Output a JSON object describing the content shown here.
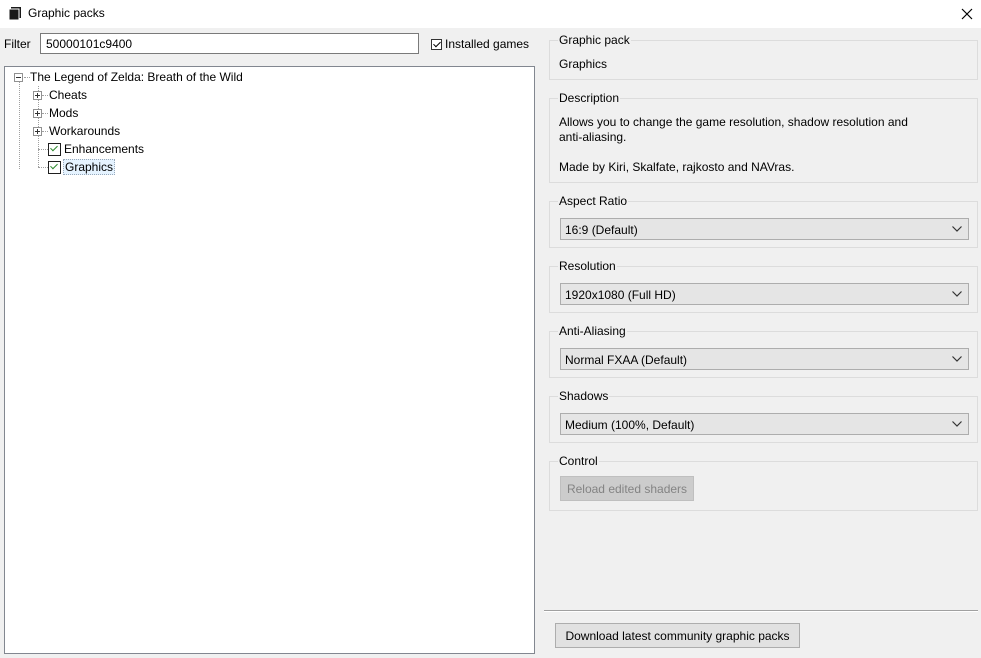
{
  "window": {
    "title": "Graphic packs"
  },
  "filter": {
    "label": "Filter",
    "value": "50000101c9400",
    "installed_games_label": "Installed games",
    "installed_games_checked": true
  },
  "tree": {
    "root": "The Legend of Zelda: Breath of the Wild",
    "items": [
      {
        "label": "Cheats",
        "type": "folder"
      },
      {
        "label": "Mods",
        "type": "folder"
      },
      {
        "label": "Workarounds",
        "type": "folder"
      },
      {
        "label": "Enhancements",
        "type": "pack",
        "checked": true
      },
      {
        "label": "Graphics",
        "type": "pack",
        "checked": true,
        "selected": true
      }
    ]
  },
  "details": {
    "graphic_pack": {
      "title": "Graphic pack",
      "value": "Graphics"
    },
    "description": {
      "title": "Description",
      "line1": "Allows you to change the game resolution, shadow resolution and",
      "line2": "anti-aliasing.",
      "line3": "Made by Kiri, Skalfate, rajkosto and NAVras."
    },
    "aspect_ratio": {
      "title": "Aspect Ratio",
      "value": "16:9 (Default)"
    },
    "resolution": {
      "title": "Resolution",
      "value": "1920x1080 (Full HD)"
    },
    "anti_aliasing": {
      "title": "Anti-Aliasing",
      "value": "Normal FXAA (Default)"
    },
    "shadows": {
      "title": "Shadows",
      "value": "Medium (100%, Default)"
    },
    "control": {
      "title": "Control",
      "reload_label": "Reload edited shaders"
    }
  },
  "footer": {
    "download_label": "Download latest community graphic packs"
  }
}
